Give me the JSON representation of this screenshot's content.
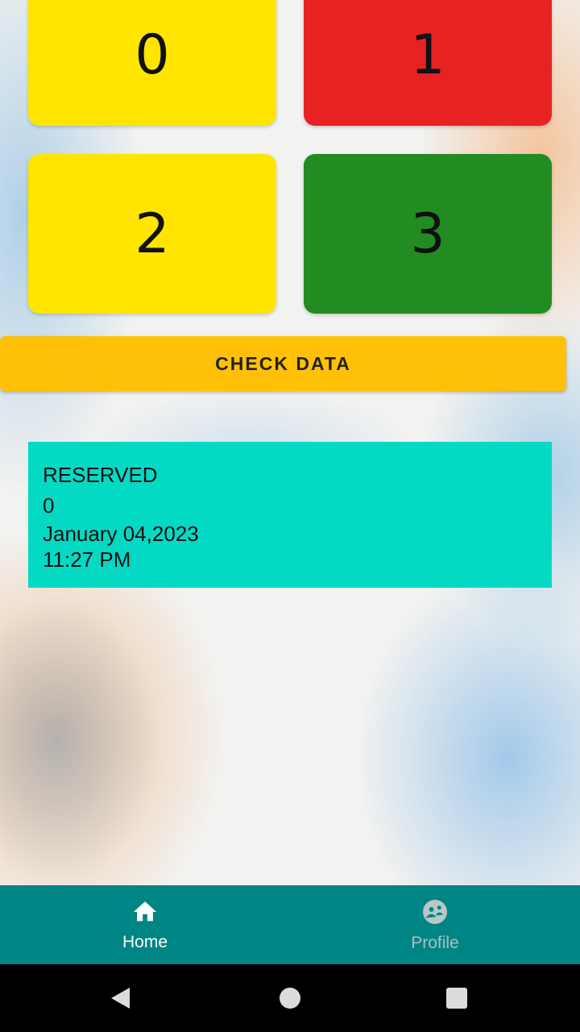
{
  "slots": [
    {
      "number": "0",
      "color": "#ffe500"
    },
    {
      "number": "1",
      "color": "#e82222"
    },
    {
      "number": "2",
      "color": "#ffe500"
    },
    {
      "number": "3",
      "color": "#228b22"
    }
  ],
  "check_button": {
    "label": "CHECK DATA",
    "color": "#ffc107"
  },
  "info_card": {
    "status": "RESERVED",
    "slot": "0",
    "date": "January 04,2023",
    "time": "11:27 PM",
    "color": "#04d9c4"
  },
  "bottom_nav": {
    "background": "#008585",
    "items": [
      {
        "label": "Home",
        "icon": "home-icon",
        "active": true
      },
      {
        "label": "Profile",
        "icon": "profile-icon",
        "active": false
      }
    ]
  },
  "system_nav": {
    "icons": [
      "back-icon",
      "home-circle-icon",
      "recents-icon"
    ]
  }
}
